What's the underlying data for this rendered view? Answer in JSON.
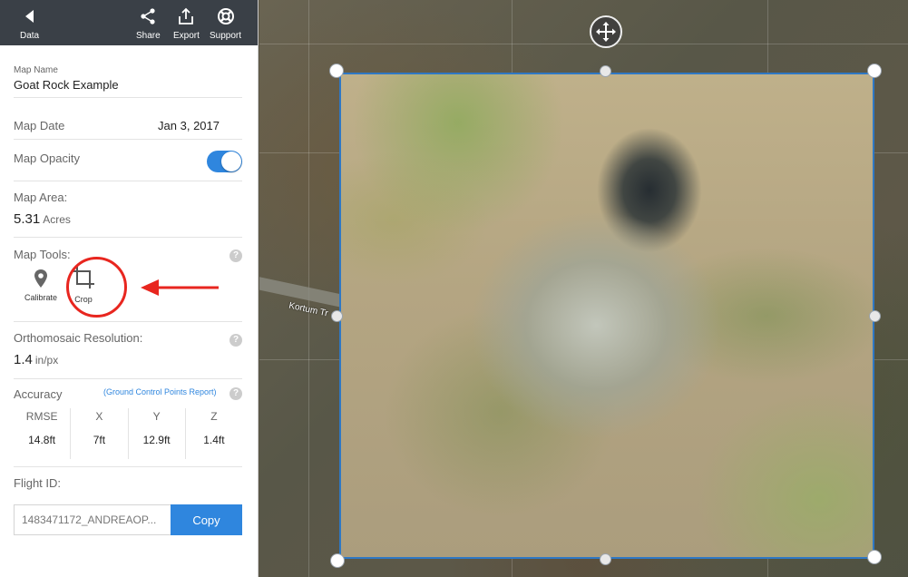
{
  "topbar": {
    "data_label": "Data",
    "share_label": "Share",
    "export_label": "Export",
    "support_label": "Support"
  },
  "map_name": {
    "label": "Map Name",
    "value": "Goat Rock Example"
  },
  "map_date": {
    "label": "Map Date",
    "value": "Jan 3, 2017"
  },
  "map_opacity": {
    "label": "Map Opacity",
    "enabled": true
  },
  "map_area": {
    "label": "Map Area:",
    "value": "5.31",
    "unit": "Acres"
  },
  "map_tools": {
    "label": "Map Tools:",
    "help": "?",
    "tools": [
      {
        "label": "Calibrate",
        "icon": "pin-icon"
      },
      {
        "label": "Crop",
        "icon": "crop-icon"
      }
    ]
  },
  "ortho": {
    "label": "Orthomosaic Resolution:",
    "help": "?",
    "value": "1.4",
    "unit": "in/px"
  },
  "accuracy": {
    "label": "Accuracy",
    "link": "(Ground Control Points Report)",
    "help": "?",
    "columns": [
      {
        "header": "RMSE",
        "value": "14.8ft"
      },
      {
        "header": "X",
        "value": "7ft"
      },
      {
        "header": "Y",
        "value": "12.9ft"
      },
      {
        "header": "Z",
        "value": "1.4ft"
      }
    ]
  },
  "flight": {
    "label": "Flight ID:",
    "value": "1483471172_ANDREAOP...",
    "copy_label": "Copy"
  },
  "map": {
    "road_label": "Kortum Tr"
  },
  "colors": {
    "accent": "#2f86de",
    "annotation": "#e8261f",
    "topbar": "#3a4047"
  }
}
